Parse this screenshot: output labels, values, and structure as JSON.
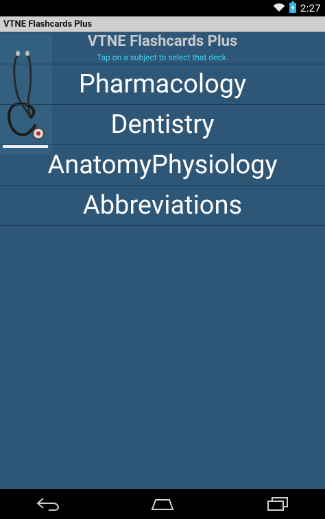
{
  "status_bar": {
    "time": "2:27",
    "icons": [
      "wifi-icon",
      "battery-charging-icon"
    ]
  },
  "app_bar": {
    "title": "VTNE Flashcards Plus"
  },
  "header": {
    "title": "VTNE Flashcards Plus",
    "subtitle": "Tap on a subject to select that deck."
  },
  "subjects": [
    {
      "label": "Pharmacology"
    },
    {
      "label": "Dentistry"
    },
    {
      "label": "AnatomyPhysiology"
    },
    {
      "label": "Abbreviations"
    }
  ],
  "nav_bar": {
    "icons": [
      "back-icon",
      "home-icon",
      "recents-icon"
    ]
  },
  "colors": {
    "background": "#2e5676",
    "subtitle": "#3ed0ee",
    "title": "#c6cbd0",
    "divider": "#1d3a52"
  }
}
